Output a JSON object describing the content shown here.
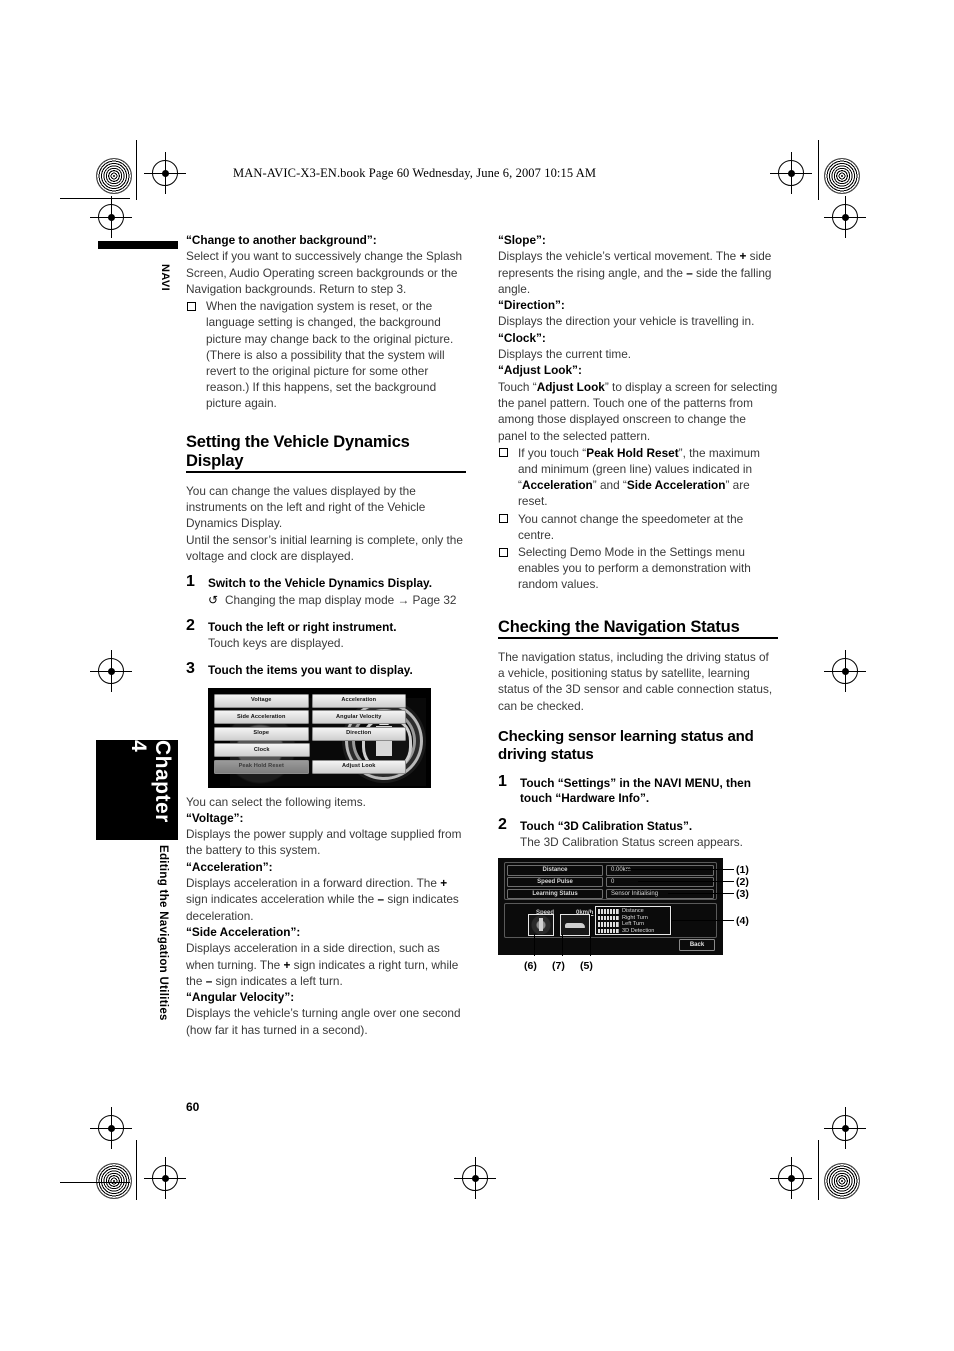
{
  "header": {
    "file_line": "MAN-AVIC-X3-EN.book  Page 60  Wednesday, June 6, 2007  10:15 AM"
  },
  "side_tabs": {
    "navi": "NAVI",
    "chapter": "Chapter 4",
    "chapter_subtitle": "Editing the Navigation Utilities"
  },
  "page_number": "60",
  "left_column": {
    "background_term": "“Change to another background”:",
    "background_body": "Select if you want to successively change the Splash Screen, Audio Operating screen backgrounds or the Navigation backgrounds. Return to step 3.",
    "background_note": "When the navigation system is reset, or the language setting is changed, the background picture may change back to the original picture. (There is also a possibility that the system will revert to the original picture for some other reason.) If this happens, set the background picture again.",
    "section_heading": "Setting the Vehicle Dynamics Display",
    "section_intro_1": "You can change the values displayed by the instruments on the left and right of the Vehicle Dynamics Display.",
    "section_intro_2": "Until the sensor’s initial learning is complete, only the voltage and clock are displayed.",
    "steps": [
      {
        "num": "1",
        "title": "Switch to the Vehicle Dynamics Display.",
        "ref_arrow": "↺",
        "ref": "Changing the map display mode → Page 32"
      },
      {
        "num": "2",
        "title": "Touch the left or right instrument.",
        "sub": "Touch keys are displayed."
      },
      {
        "num": "3",
        "title": "Touch the items you want to display."
      }
    ],
    "vdd_screen": {
      "keys": [
        [
          "Voltage",
          "Acceleration"
        ],
        [
          "Side Acceleration",
          "Angular Velocity"
        ],
        [
          "Slope",
          "Direction"
        ],
        [
          "Clock",
          ""
        ]
      ],
      "bottom_keys": [
        "Peak Hold Reset",
        "Adjust Look"
      ]
    },
    "select_items_line": "You can select the following items.",
    "terms": [
      {
        "term": "“Voltage”:",
        "body": "Displays the power supply and voltage supplied from the battery to this system."
      },
      {
        "term": "“Acceleration”:",
        "body_pre": "Displays acceleration in a forward direction. The ",
        "plus": "+",
        "body_mid": " sign indicates acceleration while the ",
        "minus": "–",
        "body_post": " sign indicates deceleration."
      },
      {
        "term": "“Side Acceleration”:",
        "body_pre": "Displays acceleration in a side direction, such as when turning. The ",
        "plus": "+",
        "body_mid": " sign indicates a right turn, while the ",
        "minus": "–",
        "body_post": " sign indicates a left turn."
      },
      {
        "term": "“Angular Velocity”:",
        "body": "Displays the vehicle’s turning angle over one second (how far it has turned in a second)."
      }
    ]
  },
  "right_column": {
    "terms": [
      {
        "term": "“Slope”:",
        "body_pre": "Displays the vehicle’s vertical movement. The ",
        "plus": "+",
        "body_mid": " side represents the rising angle, and the ",
        "minus": "–",
        "body_post": " side the falling angle."
      },
      {
        "term": "“Direction”:",
        "body": "Displays the direction your vehicle is travelling in."
      },
      {
        "term": "“Clock”:",
        "body": "Displays the current time."
      }
    ],
    "adjust_look_term": "“Adjust Look”:",
    "adjust_look_1": "Touch “",
    "adjust_look_bold": "Adjust Look",
    "adjust_look_2": "” to display a screen for selecting the panel pattern. Touch one of the patterns from among those displayed onscreen to change the panel to the selected pattern.",
    "notes": [
      {
        "pre": "If you touch “",
        "b1": "Peak Hold Reset",
        "mid1": "”, the maximum and minimum (green line) values indicated in “",
        "b2": "Acceleration",
        "mid2": "” and “",
        "b3": "Side Acceleration",
        "post": "” are reset."
      },
      {
        "text": "You cannot change the speedometer at the centre."
      },
      {
        "text": "Selecting Demo Mode in the Settings menu enables you to perform a demonstration with random values."
      }
    ],
    "section_heading": "Checking the Navigation Status",
    "section_intro": "The navigation status, including the driving status of a vehicle, positioning status by satellite, learning status of the 3D sensor and cable connection status, can be checked.",
    "sub_heading": "Checking sensor learning status and driving status",
    "steps": [
      {
        "num": "1",
        "title_1": "Touch “Settings” in the ",
        "title_bold": "NAVI MENU",
        "title_2": ", then touch “Hardware Info”."
      },
      {
        "num": "2",
        "title": "Touch “3D Calibration Status”.",
        "sub": "The 3D Calibration Status screen appears."
      }
    ],
    "calib_screen": {
      "rows": [
        {
          "label": "Distance",
          "value": "0.00km"
        },
        {
          "label": "Speed Pulse",
          "value": "0"
        },
        {
          "label": "Learning Status",
          "value": "Sensor Initialising"
        }
      ],
      "speed_label": "Speed",
      "speed_value": "0km/h",
      "bars": [
        "Distance",
        "Right Turn",
        "Left Turn",
        "3D Detection"
      ],
      "back_button": "Back",
      "callouts_right": [
        "(1)",
        "(2)",
        "(3)",
        "(4)"
      ],
      "callouts_bottom": [
        "(6)",
        "(7)",
        "(5)"
      ]
    }
  }
}
